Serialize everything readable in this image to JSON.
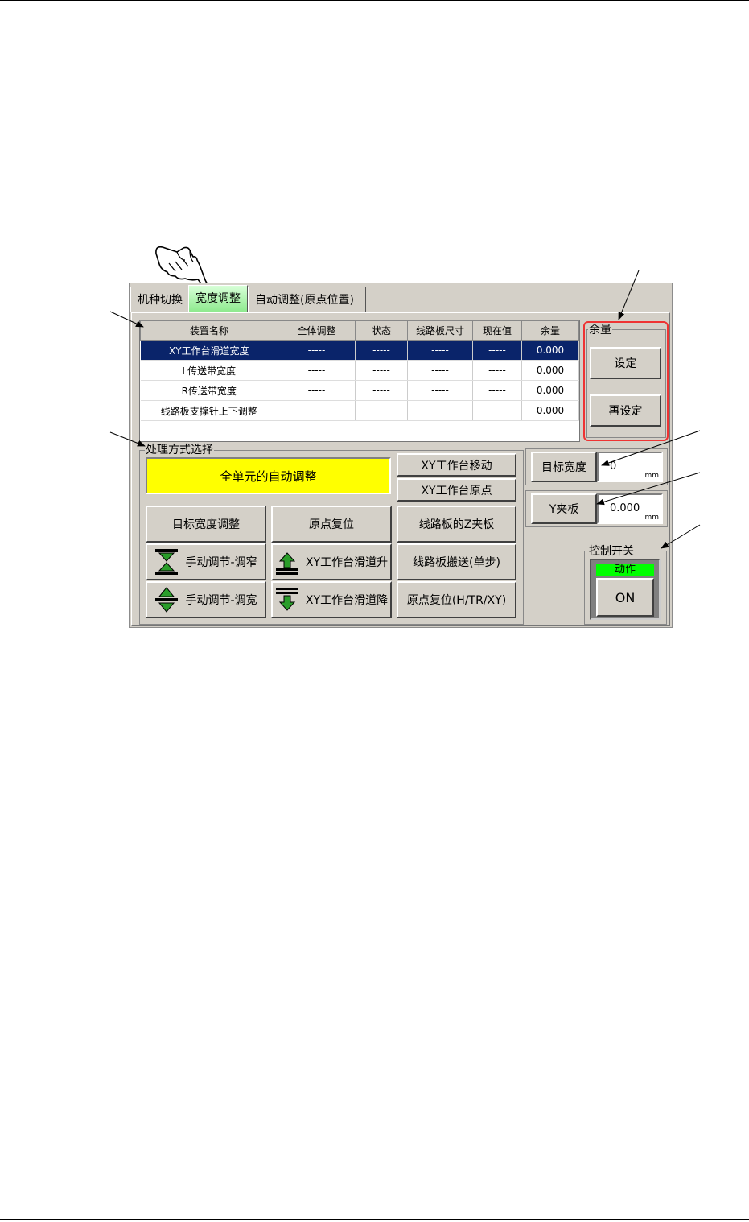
{
  "tabs": [
    "机种切换",
    "宽度调整",
    "自动调整(原点位置)"
  ],
  "table": {
    "headers": [
      "装置名称",
      "全体调整",
      "状态",
      "线路板尺寸",
      "现在值",
      "余量"
    ],
    "rows": [
      [
        "XY工作台滑道宽度",
        "-----",
        "-----",
        "-----",
        "-----",
        "0.000"
      ],
      [
        "L传送带宽度",
        "-----",
        "-----",
        "-----",
        "-----",
        "0.000"
      ],
      [
        "R传送带宽度",
        "-----",
        "-----",
        "-----",
        "-----",
        "0.000"
      ],
      [
        "线路板支撑针上下调整",
        "-----",
        "-----",
        "-----",
        "-----",
        "0.000"
      ]
    ]
  },
  "margin_group": {
    "label": "余量",
    "set_button": "设定",
    "reset_button": "再设定"
  },
  "process_group": {
    "label": "处理方式选择",
    "auto_adjust_all": "全单元的自动调整",
    "xy_move": "XY工作台移动",
    "xy_origin": "XY工作台原点",
    "target_width_adjust": "目标宽度调整",
    "origin_reset": "原点复位",
    "board_z_clamp": "线路板的Z夹板",
    "manual_narrow": "手动调节-调窄",
    "xy_rail_up": "XY工作台滑道升",
    "board_transfer_step": "线路板搬送(单步)",
    "manual_widen": "手动调节-调宽",
    "xy_rail_down": "XY工作台滑道降",
    "origin_reset_htrxy": "原点复位(H/TR/XY)"
  },
  "target_width": {
    "label": "目标宽度",
    "value": "0",
    "unit": "mm"
  },
  "y_clamp": {
    "label": "Y夹板",
    "value": "0.000",
    "unit": "mm"
  },
  "control_switch": {
    "label": "控制开关",
    "status": "动作",
    "button": "ON"
  },
  "colors": {
    "selection": "#0a246a",
    "highlight": "#ffff00",
    "status_green": "#00ff00",
    "callout_red": "#e33333"
  },
  "icons": [
    "hand-pointer-icon",
    "narrow-arrows-icon",
    "widen-arrows-icon",
    "rail-up-icon",
    "rail-down-icon"
  ]
}
